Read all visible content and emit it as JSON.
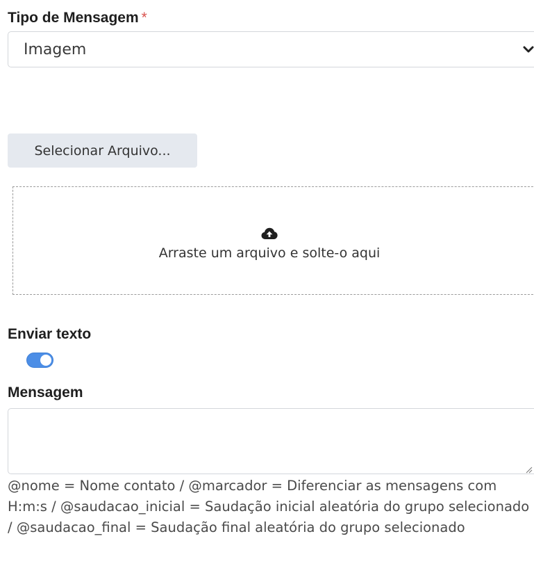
{
  "tipo_mensagem": {
    "label": "Tipo de Mensagem",
    "required_mark": "*",
    "selected": "Imagem"
  },
  "upload": {
    "button_label": "Selecionar Arquivo...",
    "dropzone_text": "Arraste um arquivo e solte-o aqui",
    "icon": "cloud-upload-icon"
  },
  "enviar_texto": {
    "label": "Enviar texto",
    "toggle_on": true
  },
  "mensagem": {
    "label": "Mensagem",
    "value": "",
    "help_text": "@nome = Nome contato / @marcador = Diferenciar as mensagens com H:m:s / @saudacao_inicial = Saudação inicial aleatória do grupo selecionado / @saudacao_final = Saudação final aleatória do grupo selecionado"
  },
  "colors": {
    "toggle_on": "#4c8ee6",
    "required": "#d9534f",
    "button_bg": "#e5e9ef"
  }
}
